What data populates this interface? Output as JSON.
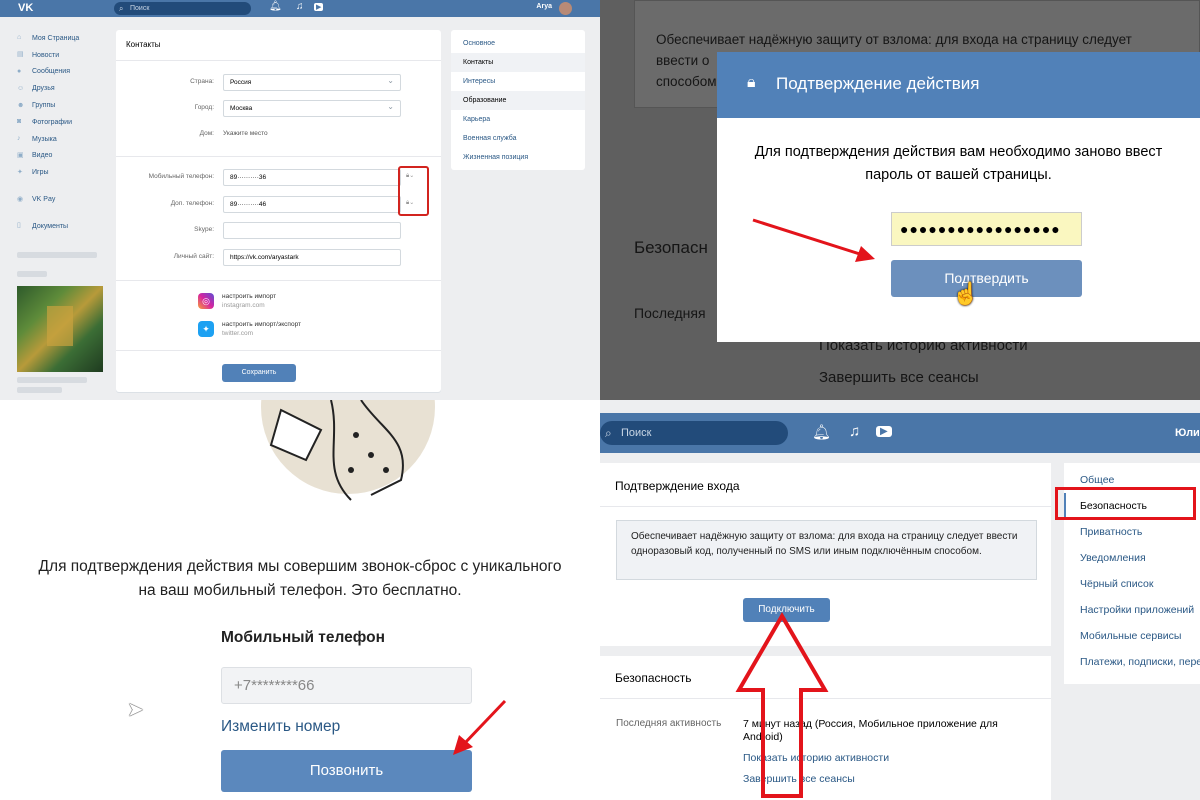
{
  "q1": {
    "header": {
      "logo": "VK",
      "search_placeholder": "Поиск",
      "user_name": "Arya"
    },
    "nav": [
      "Моя Страница",
      "Новости",
      "Сообщения",
      "Друзья",
      "Группы",
      "Фотографии",
      "Музыка",
      "Видео",
      "Игры",
      "VK Pay",
      "Документы"
    ],
    "card": {
      "title": "Контакты",
      "country_label": "Страна:",
      "country_value": "Россия",
      "city_label": "Город:",
      "city_value": "Москва",
      "home_label": "Дом:",
      "home_value": "Укажите место",
      "mobile_label": "Мобильный телефон:",
      "mobile_value": "89··········36",
      "extra_label": "Доп. телефон:",
      "extra_value": "89··········46",
      "skype_label": "Skype:",
      "skype_value": "",
      "site_label": "Личный сайт:",
      "site_value": "https://vk.com/aryastark",
      "instagram_action": "настроить импорт",
      "instagram_domain": "instagram.com",
      "twitter_action": "настроить импорт/экспорт",
      "twitter_domain": "twitter.com",
      "save": "Сохранить"
    },
    "side": [
      "Основное",
      "Контакты",
      "Интересы",
      "Образование",
      "Карьера",
      "Военная служба",
      "Жизненная позиция"
    ]
  },
  "q2": {
    "bg_text_1": "Обеспечивает надёжную защиту от взлома: для входа на страницу следует",
    "bg_text_2": "ввести о",
    "bg_text_3": "способом",
    "bg_security": "Безопасн",
    "bg_last": "Последняя",
    "bg_history": "Показать историю активности",
    "bg_end": "Завершить все сеансы",
    "modal_title": "Подтверждение действия",
    "modal_msg_1": "Для подтверждения действия вам необходимо заново ввест",
    "modal_msg_2": "пароль от вашей страницы.",
    "password": "●●●●●●●●●●●●●●●●●",
    "confirm": "Подтвердить"
  },
  "q3": {
    "msg_1": "Для подтверждения действия мы совершим звонок-сброс с уникального",
    "msg_2": "на ваш мобильный телефон. Это бесплатно.",
    "phone_label": "Мобильный телефон",
    "phone_value": "+7********66",
    "change_number": "Изменить номер",
    "call": "Позвонить"
  },
  "q4": {
    "search_placeholder": "Поиск",
    "user_name": "Юлия",
    "login_title": "Подтверждение входа",
    "login_info": "Обеспечивает надёжную защиту от взлома: для входа на страницу следует ввести одноразовый код, полученный по SMS или иным подключённым способом.",
    "connect": "Подключить",
    "security_title": "Безопасность",
    "last_activity_label": "Последняя активность",
    "last_activity_value": "7 минут назад (Россия, Мобильное приложение для Android)",
    "show_history": "Показать историю активности",
    "end_sessions": "Завершить все сеансы",
    "menu": [
      "Общее",
      "Безопасность",
      "Приватность",
      "Уведомления",
      "Чёрный список",
      "Настройки приложений",
      "Мобильные сервисы",
      "Платежи, подписки, переводы"
    ]
  },
  "colors": {
    "vk_blue": "#4a76a8",
    "button_blue": "#5181b8",
    "annotation_red": "#e3141b"
  }
}
